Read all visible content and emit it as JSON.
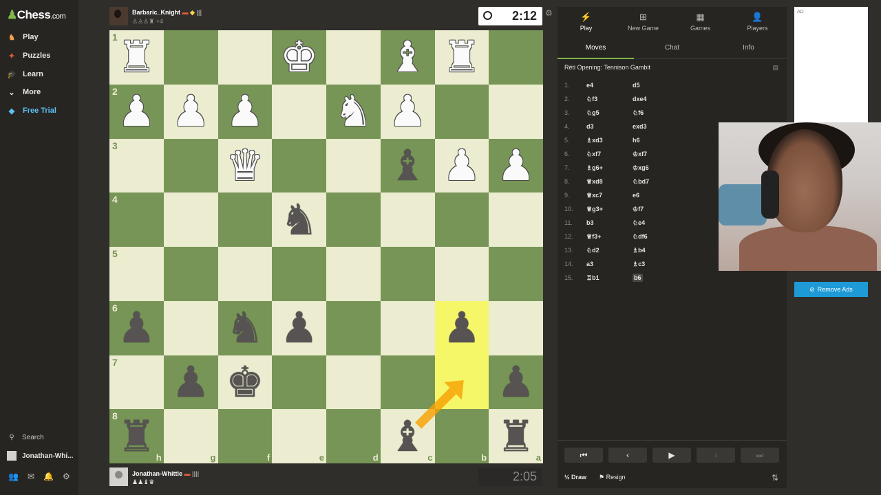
{
  "brand": {
    "logo": "Chess",
    "domain": ".com"
  },
  "sidebar": {
    "items": [
      {
        "label": "Play",
        "icon": "play-icon",
        "color": "#e8e6e3"
      },
      {
        "label": "Puzzles",
        "icon": "puzzle-icon",
        "color": "#e8e6e3"
      },
      {
        "label": "Learn",
        "icon": "learn-icon",
        "color": "#e8e6e3"
      },
      {
        "label": "More",
        "icon": "chevron-down-icon",
        "color": "#e8e6e3"
      },
      {
        "label": "Free Trial",
        "icon": "diamond-icon",
        "color": "#5cc1f2"
      }
    ],
    "search_label": "Search",
    "user_label": "Jonathan-Whi..."
  },
  "top_player": {
    "name": "Barbaric_Knight",
    "captured": "+4",
    "clock": "2:12"
  },
  "bottom_player": {
    "name": "Jonathan-Whittle",
    "clock": "2:05"
  },
  "board": {
    "orientation": "black",
    "ranks": [
      "1",
      "2",
      "3",
      "4",
      "5",
      "6",
      "7",
      "8"
    ],
    "files": [
      "h",
      "g",
      "f",
      "e",
      "d",
      "c",
      "b",
      "a"
    ],
    "highlight_squares": [
      "b6",
      "b7"
    ],
    "pieces": [
      {
        "sq": "h1",
        "p": "♜",
        "c": "w"
      },
      {
        "sq": "e1",
        "p": "♚",
        "c": "w"
      },
      {
        "sq": "c1",
        "p": "♝",
        "c": "w"
      },
      {
        "sq": "b1",
        "p": "♜",
        "c": "w"
      },
      {
        "sq": "h2",
        "p": "♟",
        "c": "w"
      },
      {
        "sq": "g2",
        "p": "♟",
        "c": "w"
      },
      {
        "sq": "f2",
        "p": "♟",
        "c": "w"
      },
      {
        "sq": "d2",
        "p": "♞",
        "c": "w"
      },
      {
        "sq": "c2",
        "p": "♟",
        "c": "w"
      },
      {
        "sq": "f3",
        "p": "♛",
        "c": "w"
      },
      {
        "sq": "c3",
        "p": "♝",
        "c": "b"
      },
      {
        "sq": "b3",
        "p": "♟",
        "c": "w"
      },
      {
        "sq": "a3",
        "p": "♟",
        "c": "w"
      },
      {
        "sq": "e4",
        "p": "♞",
        "c": "b"
      },
      {
        "sq": "h6",
        "p": "♟",
        "c": "b"
      },
      {
        "sq": "f6",
        "p": "♞",
        "c": "b"
      },
      {
        "sq": "e6",
        "p": "♟",
        "c": "b"
      },
      {
        "sq": "b6",
        "p": "♟",
        "c": "b"
      },
      {
        "sq": "g7",
        "p": "♟",
        "c": "b"
      },
      {
        "sq": "f7",
        "p": "♚",
        "c": "b"
      },
      {
        "sq": "a7",
        "p": "♟",
        "c": "b"
      },
      {
        "sq": "h8",
        "p": "♜",
        "c": "b"
      },
      {
        "sq": "c8",
        "p": "♝",
        "c": "b"
      },
      {
        "sq": "a8",
        "p": "♜",
        "c": "b"
      }
    ],
    "arrow": {
      "from": "c8",
      "to": "b7",
      "color": "#f8a100"
    }
  },
  "panel": {
    "tabs": [
      {
        "label": "Play",
        "icon": "lightning-icon"
      },
      {
        "label": "New Game",
        "icon": "plus-icon"
      },
      {
        "label": "Games",
        "icon": "board-icon"
      },
      {
        "label": "Players",
        "icon": "players-icon"
      }
    ],
    "subtabs": [
      "Moves",
      "Chat",
      "Info"
    ],
    "opening": "Réti Opening: Tennison Gambit",
    "moves": [
      {
        "n": "1.",
        "w": "e4",
        "b": "d5"
      },
      {
        "n": "2.",
        "w": "♘f3",
        "b": "dxe4"
      },
      {
        "n": "3.",
        "w": "♘g5",
        "b": "♘f6"
      },
      {
        "n": "4.",
        "w": "d3",
        "b": "exd3"
      },
      {
        "n": "5.",
        "w": "♗xd3",
        "b": "h6"
      },
      {
        "n": "6.",
        "w": "♘xf7",
        "b": "♔xf7"
      },
      {
        "n": "7.",
        "w": "♗g6+",
        "b": "♔xg6"
      },
      {
        "n": "8.",
        "w": "♕xd8",
        "b": "♘bd7"
      },
      {
        "n": "9.",
        "w": "♕xc7",
        "b": "e6"
      },
      {
        "n": "10.",
        "w": "♕g3+",
        "b": "♔f7"
      },
      {
        "n": "11.",
        "w": "b3",
        "b": "♘e4"
      },
      {
        "n": "12.",
        "w": "♕f3+",
        "b": "♘df6"
      },
      {
        "n": "13.",
        "w": "♘d2",
        "b": "♗b4"
      },
      {
        "n": "14.",
        "w": "a3",
        "b": "♗c3"
      },
      {
        "n": "15.",
        "w": "♖b1",
        "b": "b6"
      }
    ],
    "draw_label": "Draw",
    "resign_label": "Resign"
  },
  "ad": {
    "label": "AD",
    "remove_label": "Remove Ads"
  }
}
